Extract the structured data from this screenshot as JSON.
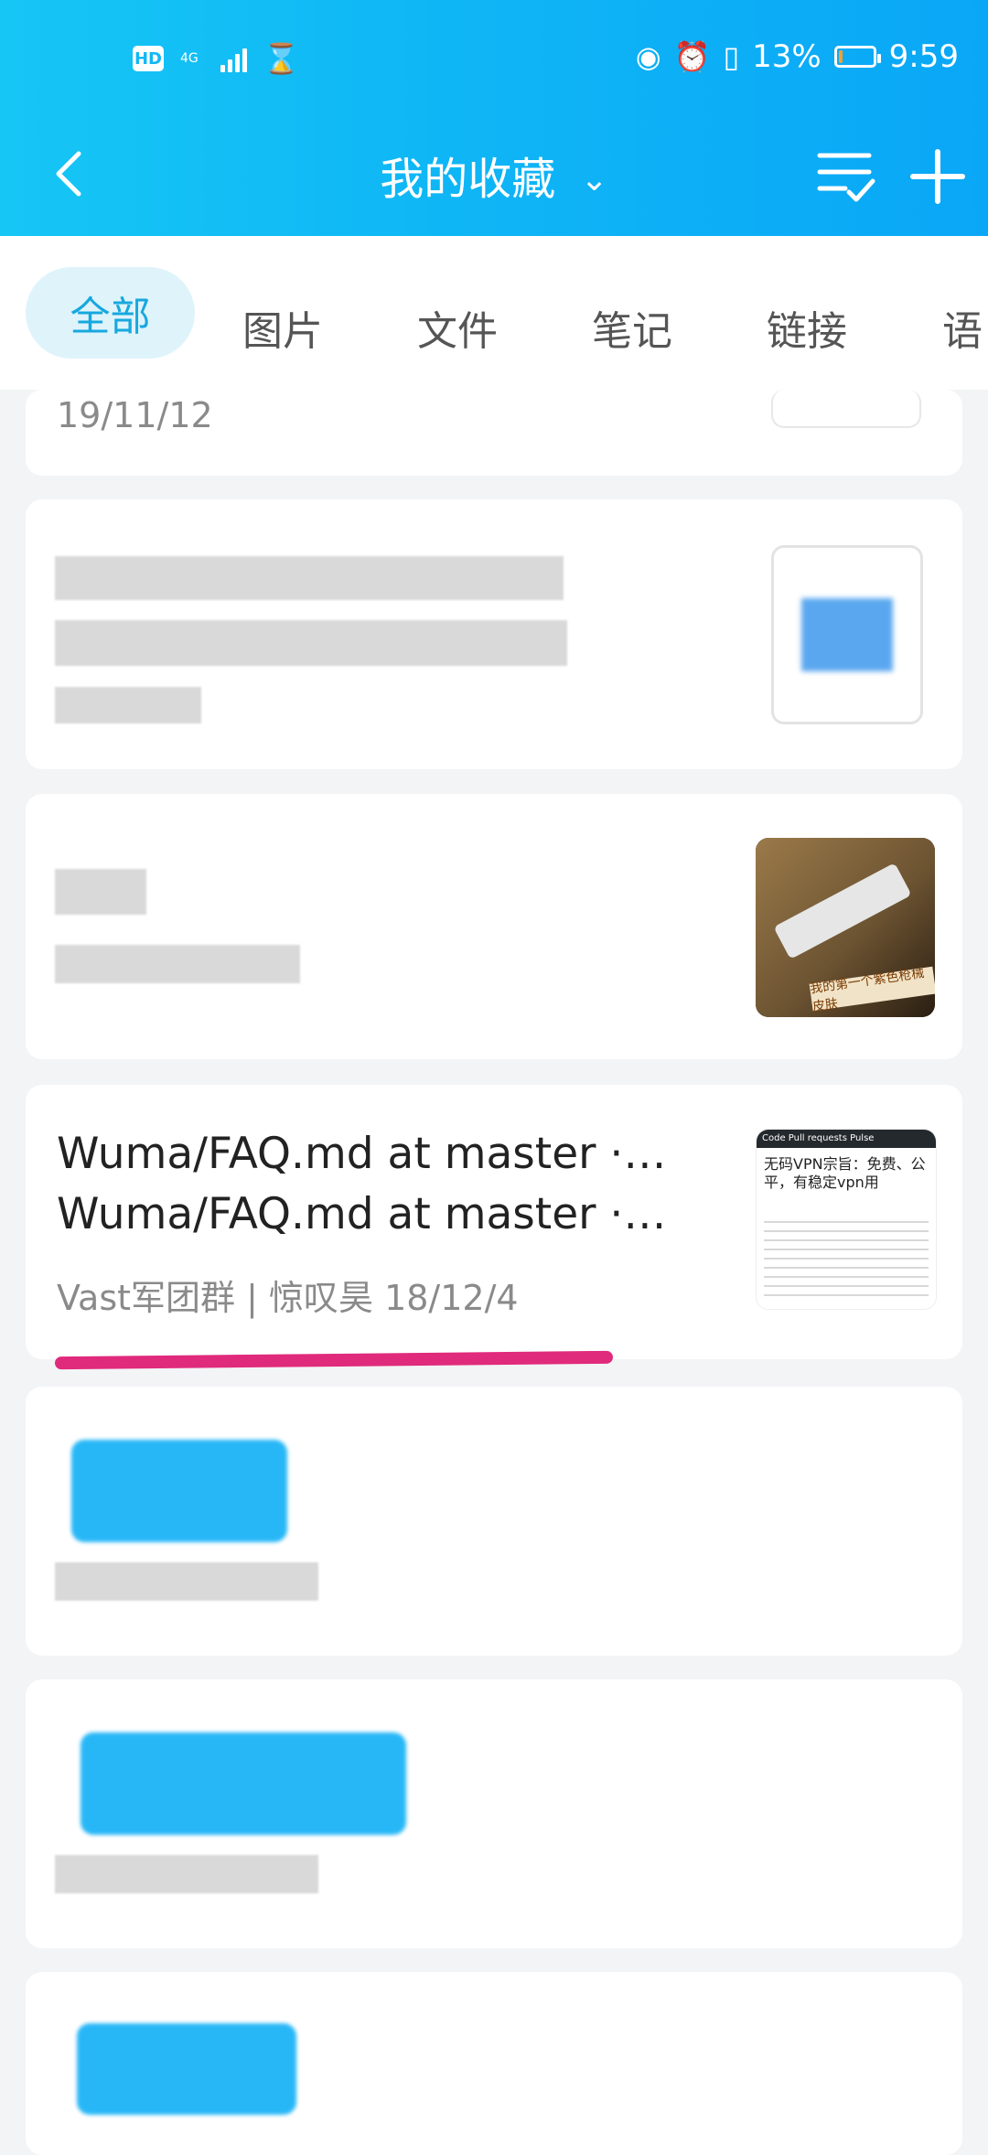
{
  "status": {
    "hd_badge": "HD",
    "network": "4G",
    "battery_percent": "13%",
    "time": "9:59",
    "battery_level": 0.13
  },
  "header": {
    "title": "我的收藏",
    "back_icon": "chevron-left-icon",
    "list_icon": "list-check-icon",
    "add_icon": "plus-icon"
  },
  "tabs": [
    {
      "label": "全部",
      "active": true
    },
    {
      "label": "图片"
    },
    {
      "label": "文件"
    },
    {
      "label": "笔记"
    },
    {
      "label": "链接"
    },
    {
      "label": "语"
    }
  ],
  "cards": {
    "first_date": "19/11/12",
    "link_card": {
      "title_line1": "Wuma/FAQ.md at master ·…",
      "title_line2": "Wuma/FAQ.md at master ·…",
      "meta": "Vast军团群 | 惊叹昊  18/12/4",
      "thumb_header": "Code  Pull requests  Pulse",
      "thumb_title": "无码VPN宗旨：免费、公平，有稳定vpn用"
    },
    "image_card": {
      "thumb_caption": "我的第一个紫色枪械皮肤"
    }
  },
  "colors": {
    "accent": "#17a8de",
    "header_gradient_start": "#16c6f5",
    "header_gradient_end": "#0aa7f6",
    "underline": "#e02a7b"
  }
}
